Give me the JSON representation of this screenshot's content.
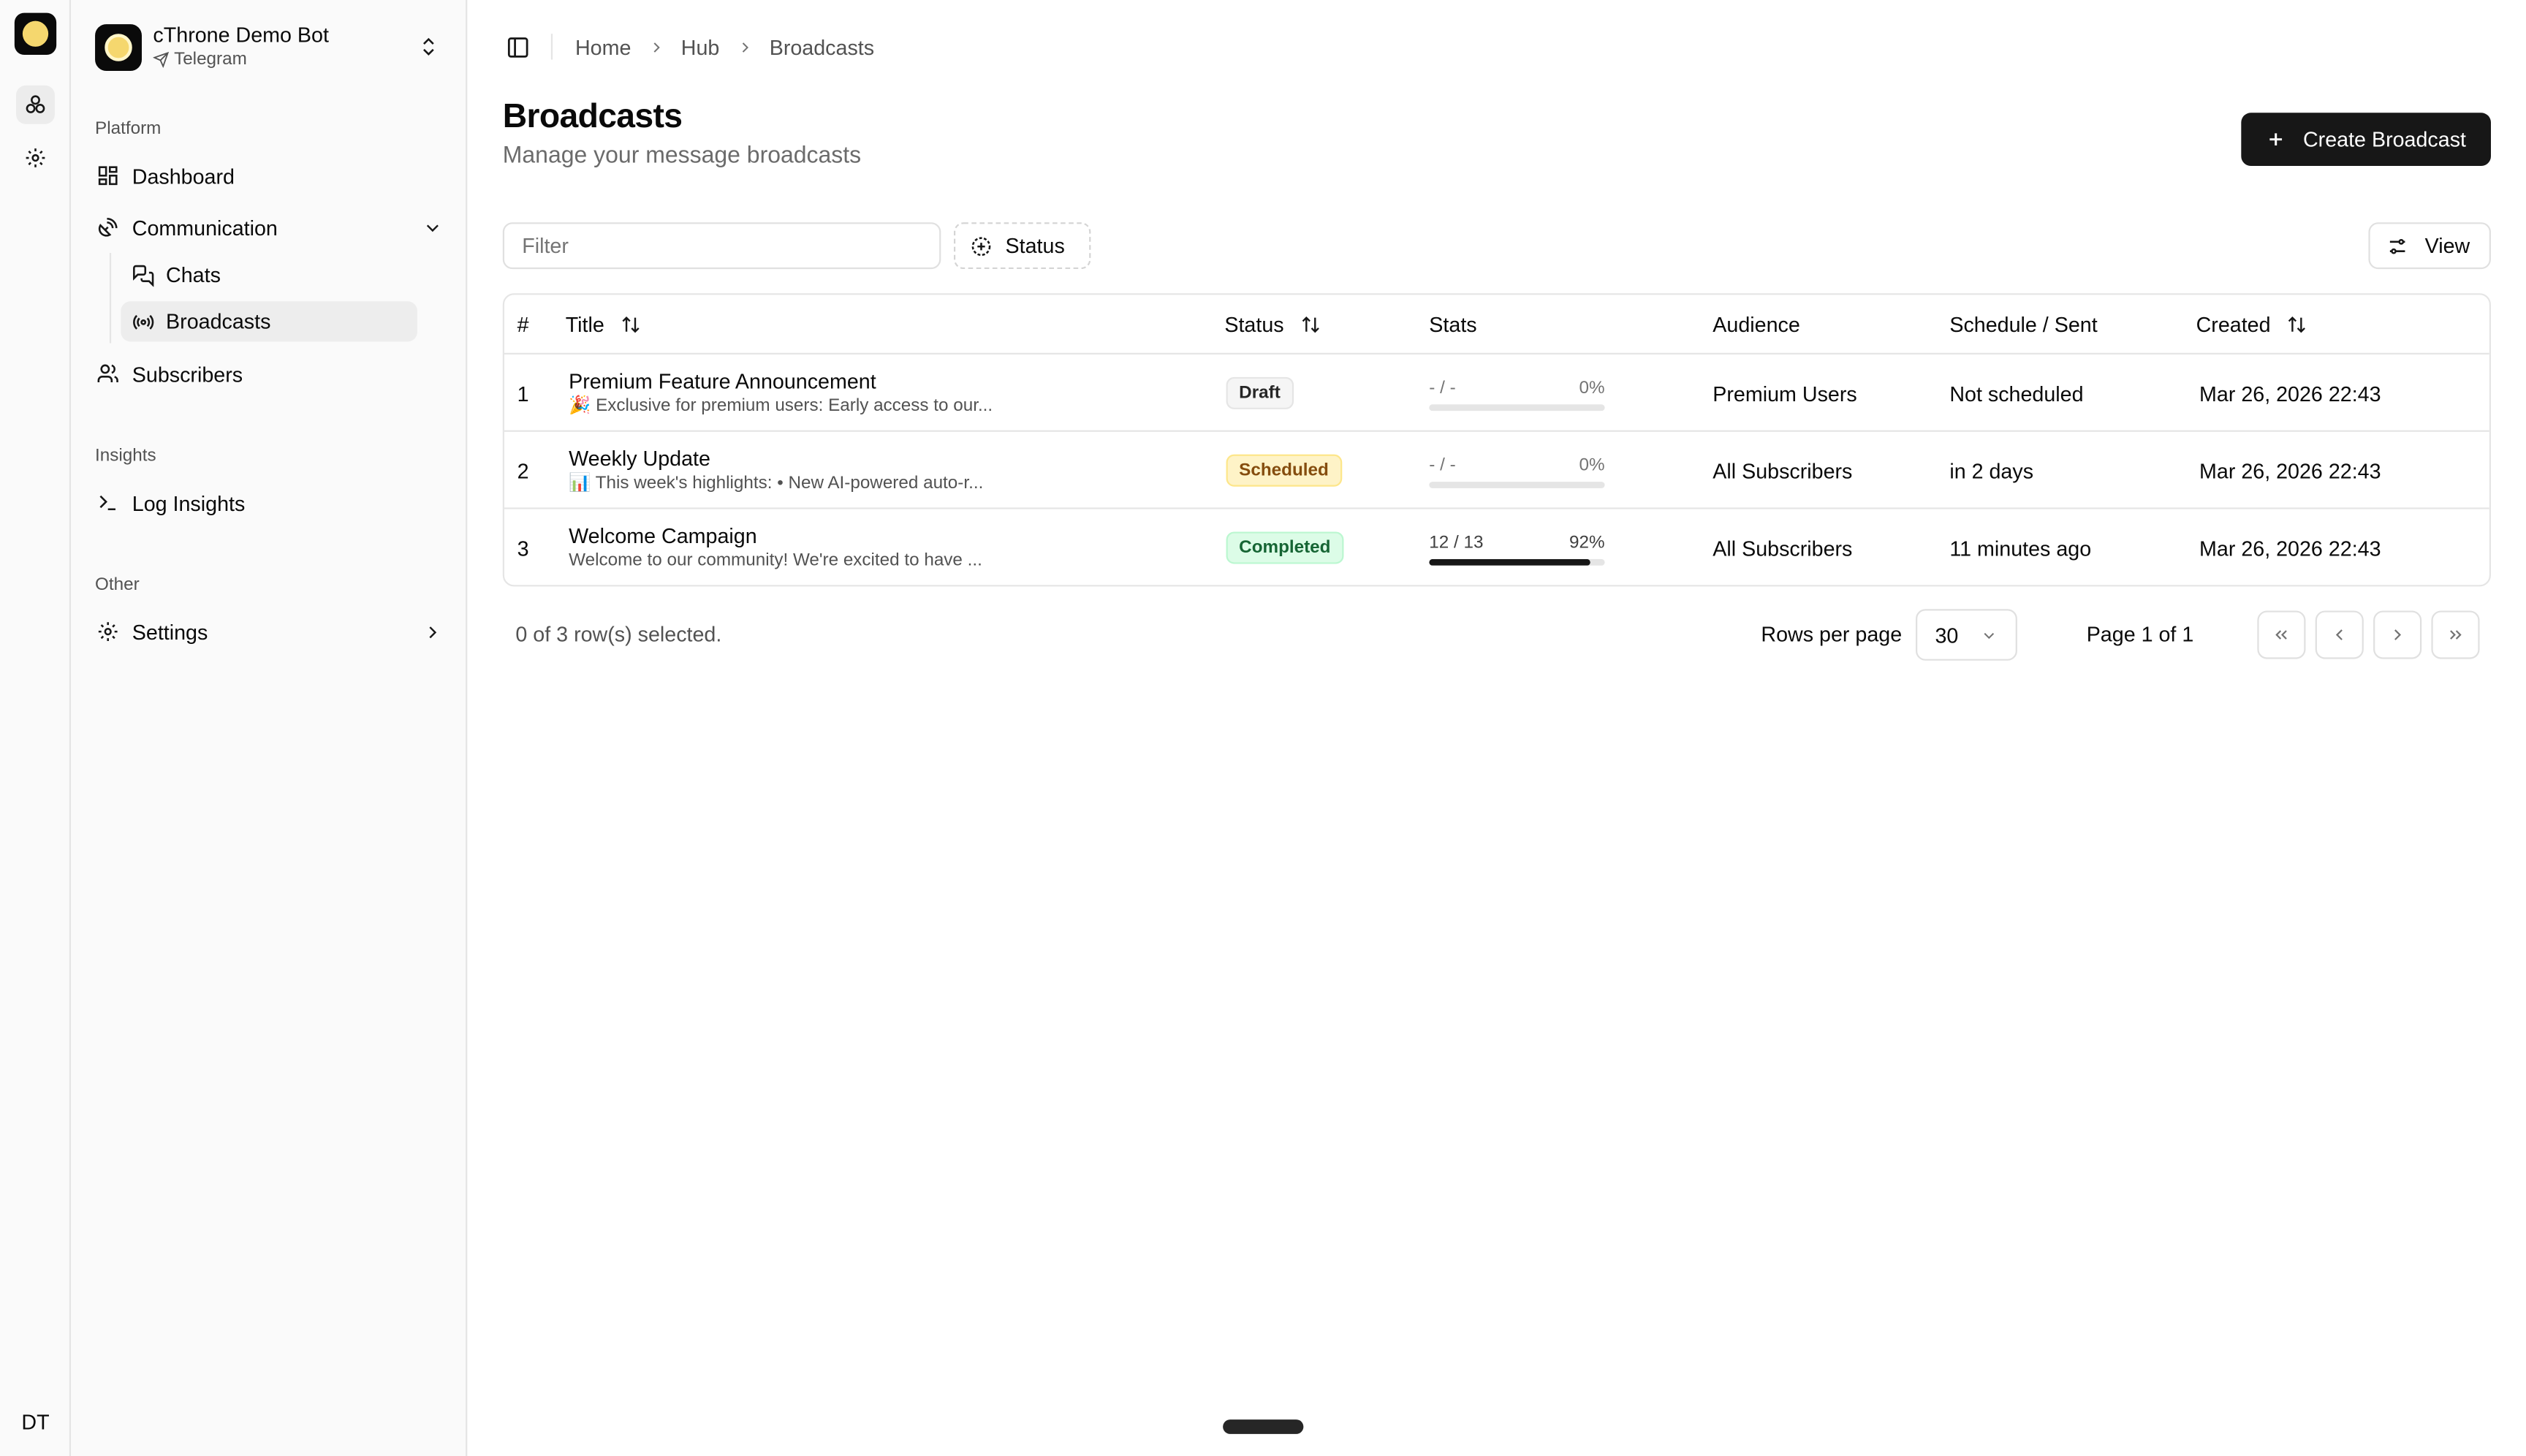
{
  "rail": {
    "avatar_initials": "DT"
  },
  "bot": {
    "name": "cThrone Demo Bot",
    "platform": "Telegram"
  },
  "sidebar": {
    "platform_label": "Platform",
    "dashboard": "Dashboard",
    "communication": "Communication",
    "chats": "Chats",
    "broadcasts": "Broadcasts",
    "subscribers": "Subscribers",
    "insights_label": "Insights",
    "log_insights": "Log Insights",
    "other_label": "Other",
    "settings": "Settings"
  },
  "breadcrumb": [
    "Home",
    "Hub",
    "Broadcasts"
  ],
  "page": {
    "title": "Broadcasts",
    "subtitle": "Manage your message broadcasts",
    "create_label": "Create Broadcast"
  },
  "toolbar": {
    "filter_placeholder": "Filter",
    "status_label": "Status",
    "view_label": "View"
  },
  "table": {
    "columns": {
      "num": "#",
      "title": "Title",
      "status": "Status",
      "stats": "Stats",
      "audience": "Audience",
      "schedule": "Schedule / Sent",
      "created": "Created"
    },
    "rows": [
      {
        "num": "1",
        "title": "Premium Feature Announcement",
        "preview": "🎉 Exclusive for premium users: Early access to our...",
        "status": "Draft",
        "stats_count": "- / -",
        "stats_percent": "0%",
        "progress": 0,
        "audience": "Premium Users",
        "schedule": "Not scheduled",
        "created": "Mar 26, 2026 22:43"
      },
      {
        "num": "2",
        "title": "Weekly Update",
        "preview": "📊 This week's highlights: • New AI-powered auto-r...",
        "status": "Scheduled",
        "stats_count": "- / -",
        "stats_percent": "0%",
        "progress": 0,
        "audience": "All Subscribers",
        "schedule": "in 2 days",
        "created": "Mar 26, 2026 22:43"
      },
      {
        "num": "3",
        "title": "Welcome Campaign",
        "preview": "Welcome to our community! We're excited to have ...",
        "status": "Completed",
        "stats_count": "12 / 13",
        "stats_percent": "92%",
        "progress": 0.92,
        "audience": "All Subscribers",
        "schedule": "11 minutes ago",
        "created": "Mar 26, 2026 22:43"
      }
    ]
  },
  "pagination": {
    "selected_text": "0 of 3 row(s) selected.",
    "rows_per_page_label": "Rows per page",
    "rows_per_page_value": "30",
    "page_info": "Page 1 of 1"
  }
}
